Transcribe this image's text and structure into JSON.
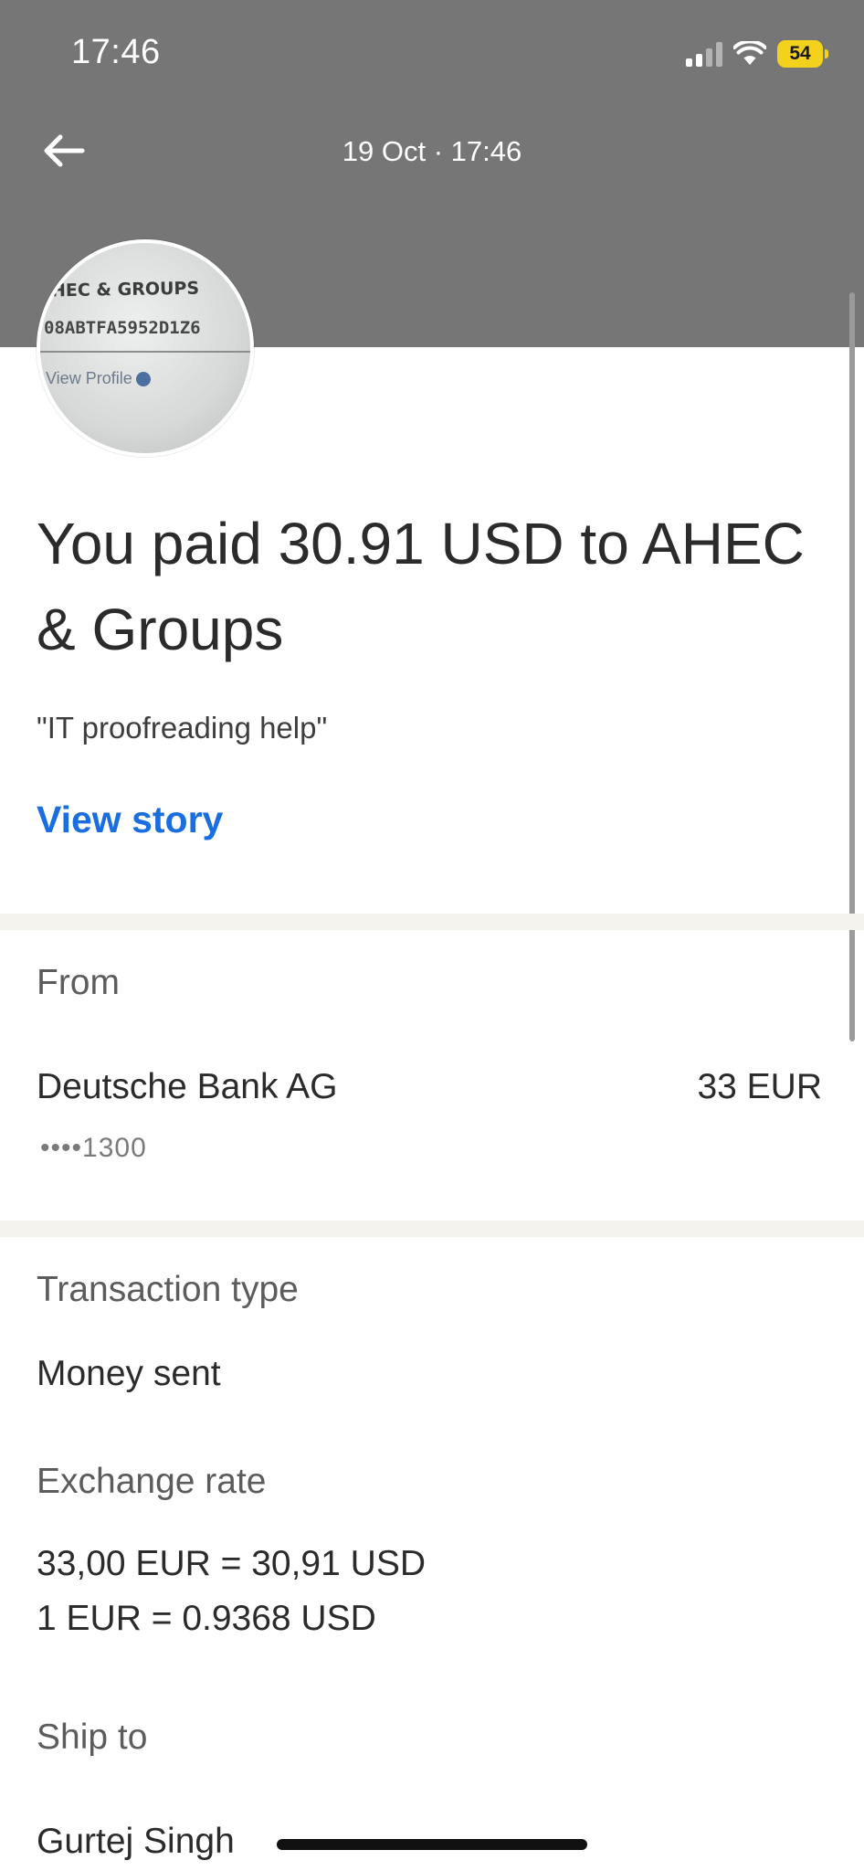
{
  "status_bar": {
    "time": "17:46",
    "battery": "54",
    "icons": [
      "cellular-signal-icon",
      "wifi-icon",
      "battery-icon"
    ]
  },
  "header": {
    "date_time": "19 Oct · 17:46",
    "back_icon": "arrow-left-icon"
  },
  "avatar": {
    "line1": "HEC & GROUPS",
    "line2": "08ABTFA5952D1Z6",
    "line3": "View Profile"
  },
  "transaction": {
    "title": "You paid 30.91 USD to AHEC & Groups",
    "note": "\"IT proofreading help\"",
    "view_story_label": "View story"
  },
  "from_section": {
    "label": "From",
    "bank_name": "Deutsche Bank AG",
    "amount": "33 EUR",
    "account_mask": "••••1300"
  },
  "details": {
    "transaction_type_label": "Transaction type",
    "transaction_type_value": "Money sent",
    "exchange_rate_label": "Exchange rate",
    "exchange_rate_line1": "33,00 EUR = 30,91 USD",
    "exchange_rate_line2": "1 EUR = 0.9368 USD",
    "ship_to_label": "Ship to",
    "ship_to_value": "Gurtej Singh"
  },
  "colors": {
    "header_background": "#767676",
    "accent_link": "#1a6fe0",
    "battery": "#f2d21c",
    "divider": "#f5f3ee"
  }
}
